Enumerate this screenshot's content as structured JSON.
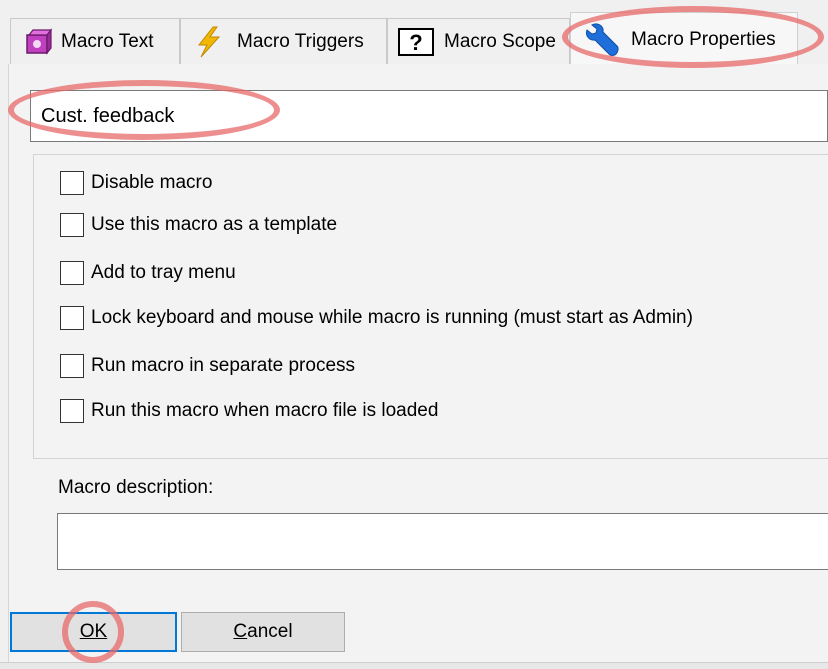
{
  "tabs": [
    {
      "label": "Macro Text",
      "icon": "macro-text-icon"
    },
    {
      "label": "Macro Triggers",
      "icon": "lightning-icon"
    },
    {
      "label": "Macro Scope",
      "icon": "question-icon"
    },
    {
      "label": "Macro Properties",
      "icon": "wrench-icon",
      "active": true
    }
  ],
  "macro_name": {
    "value": "Cust. feedback"
  },
  "options": [
    {
      "label": "Disable macro",
      "checked": false
    },
    {
      "label": "Use this macro as a template",
      "checked": false
    },
    {
      "label": "Add to tray menu",
      "checked": false
    },
    {
      "label": "Lock keyboard and mouse while macro is running (must start as Admin)",
      "checked": false
    },
    {
      "label": "Run macro in separate process",
      "checked": false
    },
    {
      "label": "Run this macro when macro file is loaded",
      "checked": false
    }
  ],
  "description": {
    "label": "Macro description:",
    "value": ""
  },
  "buttons": {
    "ok": "OK",
    "cancel": "Cancel"
  },
  "colors": {
    "highlight_ring": "#e86a6a",
    "focus_border": "#0078d7",
    "wrench": "#1e6fd9",
    "lightning": "#f2b705",
    "macro_icon": "#c040c0"
  }
}
